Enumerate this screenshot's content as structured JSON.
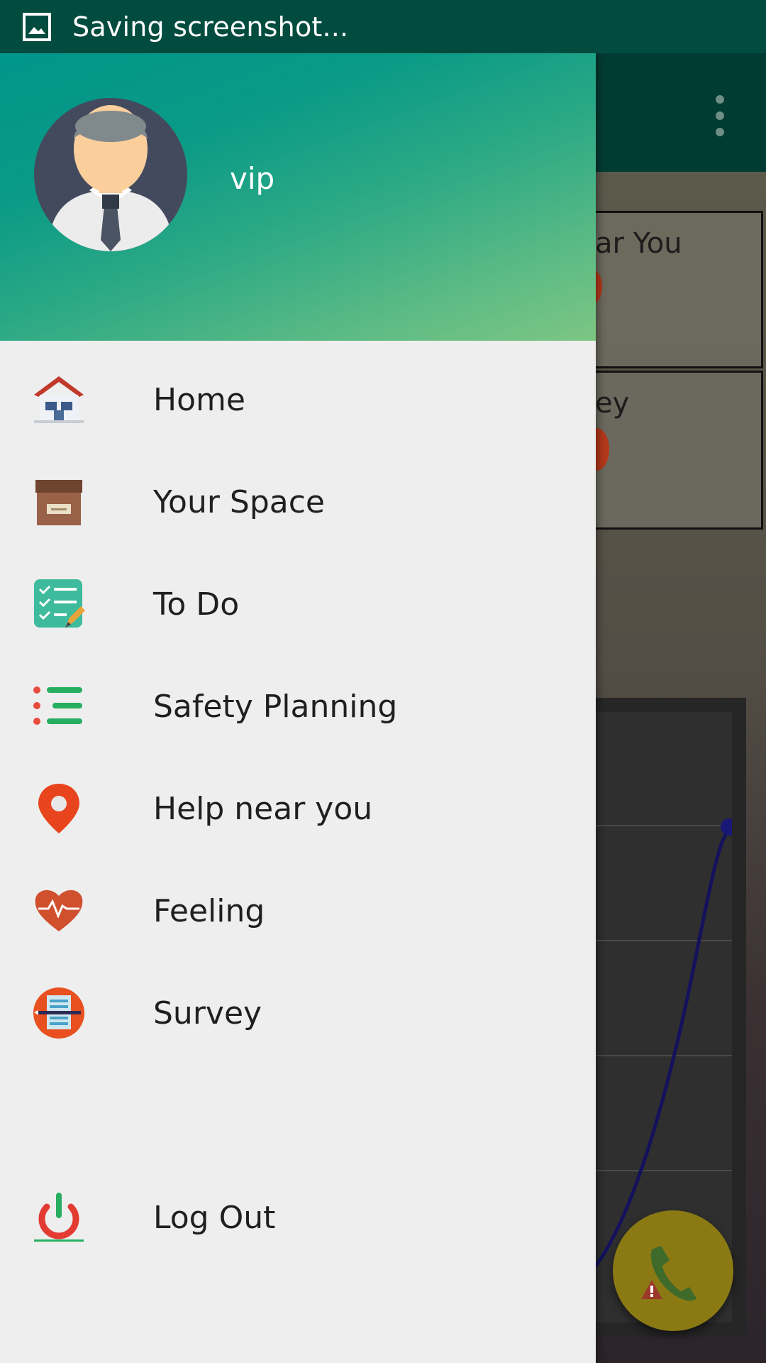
{
  "status_bar": {
    "text": "Saving screenshot..."
  },
  "drawer": {
    "username": "vip",
    "items": [
      {
        "label": "Home",
        "icon": "home-icon"
      },
      {
        "label": "Your Space",
        "icon": "box-icon"
      },
      {
        "label": "To Do",
        "icon": "checklist-icon"
      },
      {
        "label": "Safety Planning",
        "icon": "list-icon"
      },
      {
        "label": "Help near you",
        "icon": "location-pin-icon"
      },
      {
        "label": "Feeling",
        "icon": "heart-pulse-icon"
      },
      {
        "label": "Survey",
        "icon": "survey-icon"
      }
    ],
    "logout": {
      "label": "Log Out",
      "icon": "power-icon"
    }
  },
  "background": {
    "card1_label": "ar You",
    "card2_label": "ey"
  },
  "colors": {
    "status_bar": "#024b3f",
    "toolbar": "#013c33",
    "header_start": "#00968a",
    "header_end": "#7dc683",
    "drawer_bg": "#eeeeee",
    "fab": "#8b7a14"
  }
}
